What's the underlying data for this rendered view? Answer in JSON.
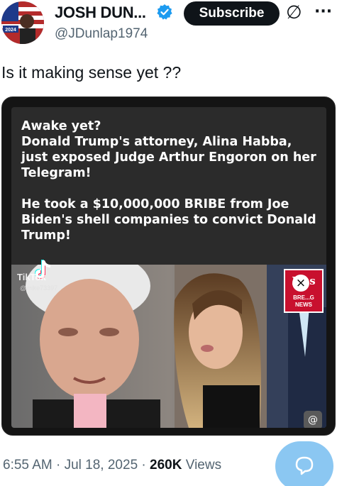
{
  "header": {
    "display_name": "JOSH DUN...",
    "handle": "@JDunlap1974",
    "subscribe_label": "Subscribe",
    "avatar_text": "2024",
    "grok_icon": "∅",
    "more_icon": "···"
  },
  "tweet": {
    "text": "Is it making sense yet ??"
  },
  "media": {
    "line1": "Awake yet?",
    "line2": "Donald Trump's attorney, Alina Habba, just exposed Judge Arthur Engoron on her Telegram!",
    "line3": "He took a $10,000,000 BRIBE from Joe Biden's shell companies to convict Donald Trump!",
    "tiktok_label": "TikTok",
    "tiktok_user": "@mike73397",
    "fox_title": "Fo s",
    "fox_sub": "BRE...G NEWS",
    "close_icon": "×",
    "at_icon": "@"
  },
  "footer": {
    "time": "6:55 AM",
    "date": "Jul 18, 2025",
    "views_count": "260K",
    "views_label": "Views"
  },
  "colors": {
    "accent": "#1d9bf0",
    "text": "#0f1419",
    "muted": "#536471",
    "reply_fab": "#8bc7f2",
    "fox_red": "#c8102e"
  }
}
